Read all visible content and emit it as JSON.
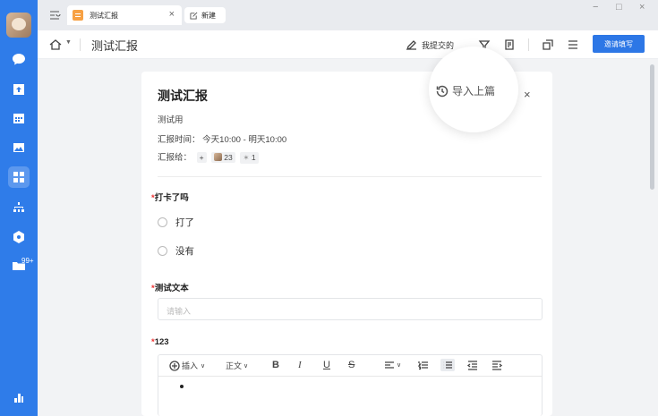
{
  "tabs": {
    "active_label": "测试汇报",
    "close_glyph": "×",
    "new_label": "新建"
  },
  "window": {
    "min": "−",
    "max": "□",
    "close": "×"
  },
  "rail": {
    "badge": "99+"
  },
  "header": {
    "title": "测试汇报",
    "submitted_label": "我提交的",
    "invite_label": "邀请填写"
  },
  "import": {
    "label": "导入上篇"
  },
  "form": {
    "title": "测试汇报",
    "close_glyph": "×",
    "description": "测试用",
    "time_label": "汇报时间：",
    "time_value": "今天10:00 - 明天10:00",
    "report_to_label": "汇报给：",
    "add_glyph": "+",
    "recipient_count": "23",
    "recipient_extra": "1",
    "required_mark": "*",
    "q1": {
      "label": "打卡了吗",
      "options": [
        "打了",
        "没有"
      ]
    },
    "q2": {
      "label": "测试文本",
      "placeholder": "请输入"
    },
    "q3": {
      "label": "123"
    },
    "toolbar": {
      "insert": "插入",
      "text_style": "正文",
      "bold": "B",
      "italic": "I",
      "underline": "U",
      "strike": "S"
    }
  },
  "colors": {
    "rail": "#2f7ce9",
    "accent": "#2d77e6",
    "required": "#e33333"
  }
}
